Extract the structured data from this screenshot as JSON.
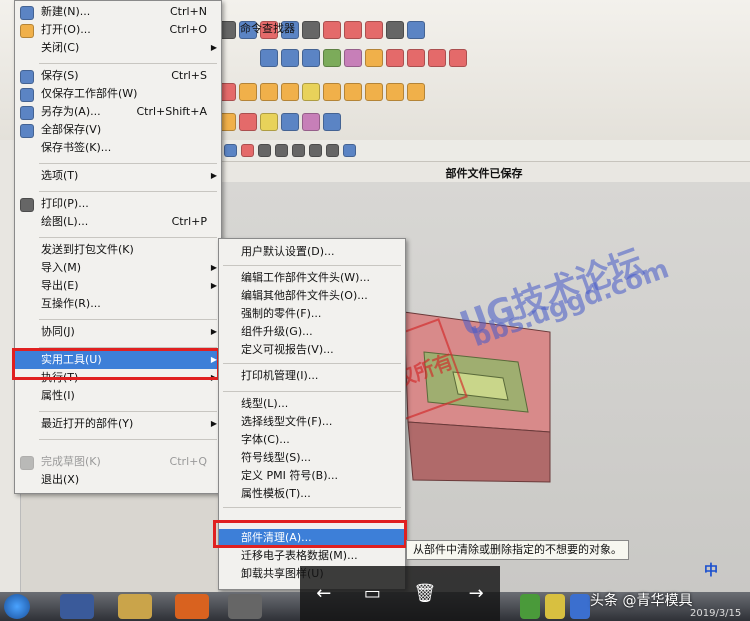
{
  "toolbar": {
    "cmd_finder": "命令查找器"
  },
  "status": {
    "text": "部件文件已保存"
  },
  "file_menu": {
    "items": [
      {
        "label": "新建(N)...",
        "shortcut": "Ctrl+N"
      },
      {
        "label": "打开(O)...",
        "shortcut": "Ctrl+O"
      },
      {
        "label": "关闭(C)",
        "submenu": true
      },
      {
        "label": "保存(S)",
        "shortcut": "Ctrl+S"
      },
      {
        "label": "仅保存工作部件(W)"
      },
      {
        "label": "另存为(A)...",
        "shortcut": "Ctrl+Shift+A"
      },
      {
        "label": "全部保存(V)"
      },
      {
        "label": "保存书签(K)..."
      },
      {
        "label": "选项(T)",
        "submenu": true
      },
      {
        "label": "打印(P)..."
      },
      {
        "label": "绘图(L)...",
        "shortcut": "Ctrl+P"
      },
      {
        "label": "发送到打包文件(K)"
      },
      {
        "label": "导入(M)",
        "submenu": true
      },
      {
        "label": "导出(E)",
        "submenu": true
      },
      {
        "label": "互操作(R)..."
      },
      {
        "label": "协同(J)",
        "submenu": true
      },
      {
        "label": "实用工具(U)",
        "submenu": true
      },
      {
        "label": "执行(T)",
        "submenu": true
      },
      {
        "label": "属性(I)"
      },
      {
        "label": "最近打开的部件(Y)",
        "submenu": true
      },
      {
        "label": "完成草图(K)",
        "shortcut": "Ctrl+Q",
        "disabled": true
      },
      {
        "label": "退出(X)"
      }
    ]
  },
  "submenu": {
    "items": [
      "用户默认设置(D)...",
      "编辑工作部件文件头(W)...",
      "编辑其他部件文件头(O)...",
      "强制的零件(F)...",
      "组件升级(G)...",
      "定义可视报告(V)...",
      "打印机管理(I)...",
      "线型(L)...",
      "选择线型文件(F)...",
      "字体(C)...",
      "符号线型(S)...",
      "定义 PMI 符号(B)...",
      "属性模板(T)...",
      "部件清理(A)...",
      "迁移电子表格数据(M)...",
      "卸载共享图样(U)"
    ]
  },
  "tooltip": "从部件中清除或删除指定的不想要的对象。",
  "watermark": {
    "title": "UG技术论坛",
    "url": "bbs.uggd.com",
    "stamp": "版权所有"
  },
  "taskbar": {
    "news": "头条 @青华模具",
    "date": "2019/3/15",
    "ime": "中"
  }
}
